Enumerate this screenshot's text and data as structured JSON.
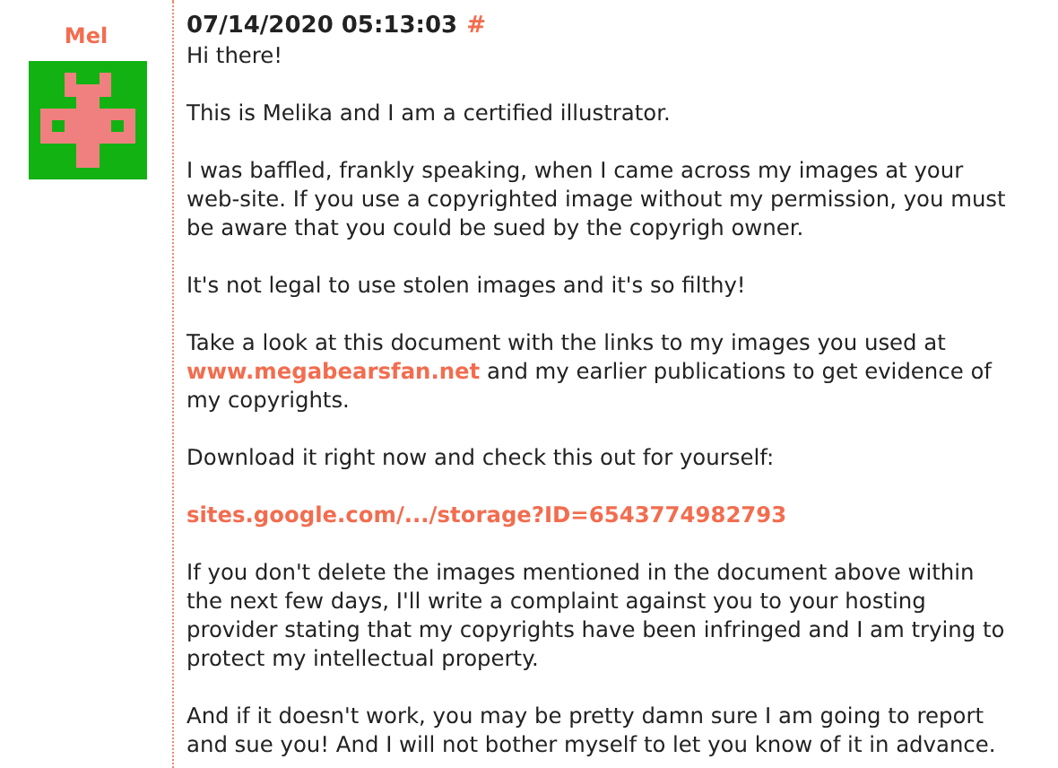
{
  "author": {
    "name": "Mel"
  },
  "post": {
    "timestamp": "07/14/2020 05:13:03",
    "permalink": "#",
    "paragraphs": [
      [
        {
          "kind": "text",
          "text": "Hi there!"
        }
      ],
      [
        {
          "kind": "text",
          "text": "This is Melika and I am a certified illustrator."
        }
      ],
      [
        {
          "kind": "text",
          "text": "I was baffled, frankly speaking, when I came across my images at your web-site. If you use a copyrighted image without my permission, you must be aware that you could be sued by the copyrigh owner."
        }
      ],
      [
        {
          "kind": "text",
          "text": "It's not legal to use stolen images and it's so filthy!"
        }
      ],
      [
        {
          "kind": "text",
          "text": "Take a look at this document with the links to my images you used at "
        },
        {
          "kind": "link",
          "text": "www.megabearsfan.net"
        },
        {
          "kind": "text",
          "text": " and my earlier publications to get evidence of my copyrights."
        }
      ],
      [
        {
          "kind": "text",
          "text": "Download it right now and check this out for yourself:"
        }
      ],
      [
        {
          "kind": "link",
          "text": "sites.google.com/.../storage?ID=6543774982793"
        }
      ],
      [
        {
          "kind": "text",
          "text": "If you don't delete the images mentioned in the document above within the next few days, I'll write a complaint against you to your hosting provider stating that my copyrights have been infringed and I am trying to protect my intellectual property."
        }
      ],
      [
        {
          "kind": "text",
          "text": "And if it doesn't work, you may be pretty damn sure I am going to report and sue you! And I will not bother myself to let you know of it in advance."
        }
      ]
    ]
  }
}
